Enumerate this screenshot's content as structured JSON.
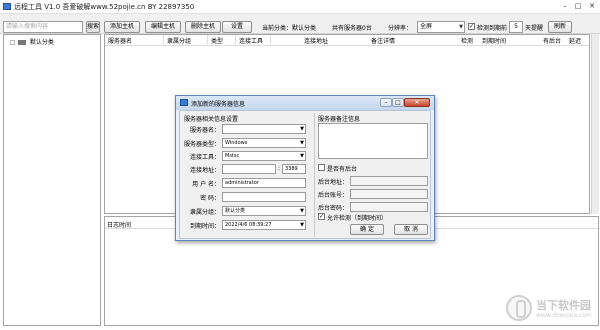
{
  "window": {
    "title": "远程工具 V1.0   吾爱破解www.52pojie.cn BY 22897350",
    "min_glyph": "–",
    "max_glyph": "□",
    "close_glyph": "✕"
  },
  "toolbar": {
    "search_placeholder": "请输入搜索内容",
    "search_button": "搜索",
    "add_button": "添加主机",
    "edit_button": "编辑主机",
    "delete_button": "删除主机",
    "settings_button": "设置",
    "current_group": "当前分类：默认分类",
    "server_count": "共有服务器0台",
    "screen_label": "分辨率：",
    "screen_value": "全屏",
    "expire_checked": "✓",
    "expire_label": "检测到期前",
    "days_value": "5",
    "days_label": "天提醒",
    "refresh_button": "刷新"
  },
  "sidebar": {
    "items": [
      {
        "expander": "□",
        "label": "默认分类"
      }
    ]
  },
  "grid": {
    "columns": [
      "服务器名",
      "隶属分组",
      "类型",
      "连接工具",
      "连接地址",
      "备注详情",
      "检测",
      "到期时间",
      "有后台",
      "延迟"
    ]
  },
  "log": {
    "header": "日志时间"
  },
  "watermark": {
    "title": "当下软件园",
    "url": "www.downxia.com"
  },
  "dialog": {
    "title": "添加新的服务器信息",
    "min_glyph": "–",
    "max_glyph": "□",
    "close_glyph": "✕",
    "left_section": "服务器相关信息设置",
    "right_section": "服务器备注信息",
    "fields": {
      "server_name_label": "服务器名：",
      "server_name_value": "",
      "server_type_label": "服务器类型：",
      "server_type_value": "Windows",
      "conn_tool_label": "连接工具：",
      "conn_tool_value": "Mstsc",
      "conn_addr_label": "连接地址：",
      "conn_addr_value": "",
      "port_sep": ":",
      "port_value": "3389",
      "username_label": "用 户 名：",
      "username_value": "administrator",
      "password_label": "密    码：",
      "password_value": "",
      "group_label": "隶属分组：",
      "group_value": "默认分类",
      "expire_label": "到期时间：",
      "expire_value": "2022/4/6 08:39:27"
    },
    "backend": {
      "has_backend_label": "是否有后台",
      "addr_label": "后台地址：",
      "account_label": "后台账号：",
      "password_label": "后台密码：",
      "allow_check_label": "允许检测（到期时间）",
      "allow_check_mark": "✓"
    },
    "ok_button": "确  定",
    "cancel_button": "取  消"
  }
}
